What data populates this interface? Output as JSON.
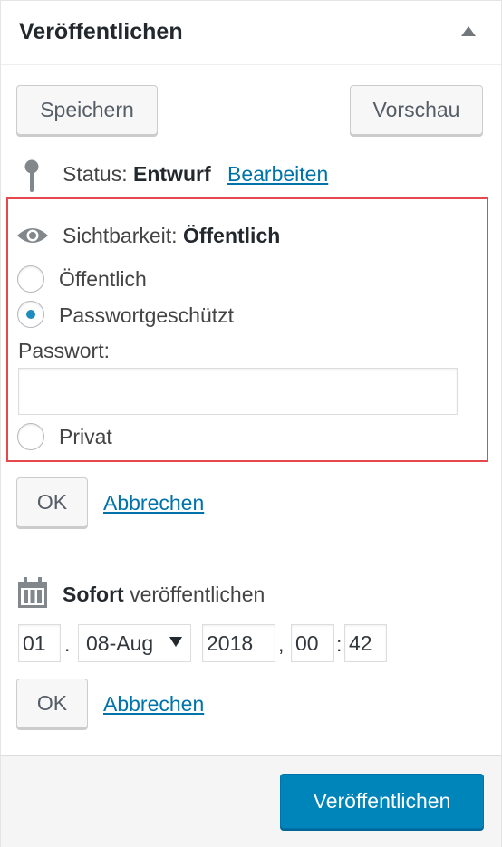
{
  "header": {
    "title": "Veröffentlichen",
    "toggle_icon": "arrow-up-icon"
  },
  "actions": {
    "save_label": "Speichern",
    "preview_label": "Vorschau"
  },
  "status": {
    "label": "Status:",
    "value": "Entwurf",
    "edit_link": "Bearbeiten",
    "icon": "pin-icon"
  },
  "visibility": {
    "label": "Sichtbarkeit:",
    "value": "Öffentlich",
    "icon": "eye-icon",
    "options": [
      {
        "label": "Öffentlich",
        "checked": false
      },
      {
        "label": "Passwortgeschützt",
        "checked": true
      },
      {
        "label": "Privat",
        "checked": false
      }
    ],
    "password_label": "Passwort:",
    "password_value": "",
    "ok_label": "OK",
    "cancel_label": "Abbrechen",
    "highlight_color": "#e5484d"
  },
  "schedule": {
    "icon": "calendar-icon",
    "label_bold": "Sofort",
    "label_rest": "veröffentlichen",
    "day": "01",
    "month": "08-Aug",
    "year": "2018",
    "hour": "00",
    "minute": "42",
    "sep_day": ".",
    "sep_year": ",",
    "sep_time": ":",
    "ok_label": "OK",
    "cancel_label": "Abbrechen"
  },
  "footer": {
    "publish_label": "Veröffentlichen",
    "accent": "#0085ba"
  }
}
